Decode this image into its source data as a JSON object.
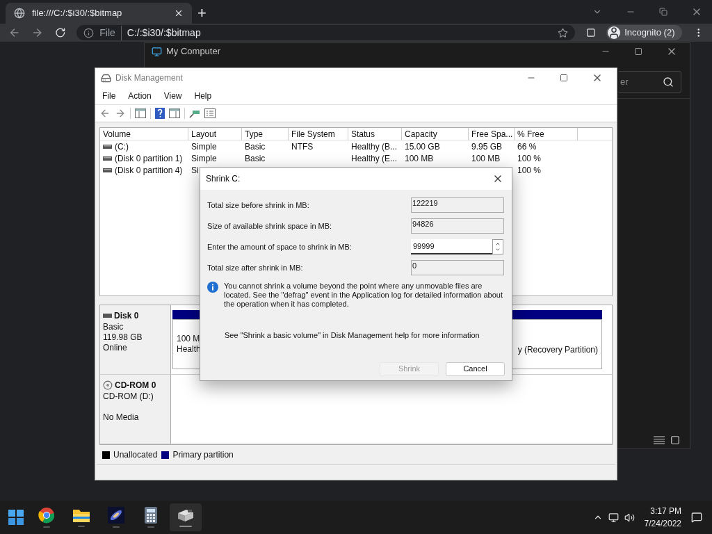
{
  "browser": {
    "tab_title": "file:///C:/:$i30/:$bitmap",
    "new_tab": "+",
    "address_scheme": "File",
    "address": "C:/:$i30/:$bitmap",
    "profile": "Incognito (2)"
  },
  "my_computer": {
    "title": "My Computer",
    "search": {
      "placeholder": "er"
    }
  },
  "disk_management": {
    "title": "Disk Management",
    "menu": [
      "File",
      "Action",
      "View",
      "Help"
    ],
    "table": {
      "columns": [
        "Volume",
        "Layout",
        "Type",
        "File System",
        "Status",
        "Capacity",
        "Free Spa...",
        "% Free"
      ],
      "rows": [
        {
          "cells": [
            " (C:)",
            "Simple",
            "Basic",
            "NTFS",
            "Healthy (B...",
            "15.00 GB",
            "9.95 GB",
            "66 %"
          ]
        },
        {
          "cells": [
            "(Disk 0 partition 1)",
            "Simple",
            "Basic",
            null,
            "Healthy (E...",
            "100 MB",
            "100 MB",
            "100 %"
          ]
        },
        {
          "cells": [
            "(Disk 0 partition 4)",
            "Si",
            null,
            null,
            null,
            null,
            null,
            "100 %"
          ]
        }
      ]
    },
    "disks": [
      {
        "kind": "disk",
        "name": "Disk 0",
        "lines": [
          "Basic",
          "119.98 GB",
          "Online"
        ],
        "partition_left": [
          "100 M",
          "Health"
        ],
        "partition_right": "y (Recovery Partition)"
      },
      {
        "kind": "cdrom",
        "name": "CD-ROM 0",
        "lines": [
          "CD-ROM (D:)",
          "No Media"
        ]
      }
    ],
    "legend": [
      {
        "label": "Unallocated",
        "color": "#000000"
      },
      {
        "label": "Primary partition",
        "color": "#000080"
      }
    ]
  },
  "dialog": {
    "title": "Shrink C:",
    "fields": [
      {
        "label": "Total size before shrink in MB:",
        "value": "122219",
        "kind": "readonly"
      },
      {
        "label": "Size of available shrink space in MB:",
        "value": "94826",
        "kind": "readonly"
      },
      {
        "label": "Enter the amount of space to shrink in MB:",
        "value": "99999",
        "kind": "spin"
      },
      {
        "label": "Total size after shrink in MB:",
        "value": "0",
        "kind": "readonly"
      }
    ],
    "info": "You cannot shrink a volume beyond the point where any unmovable files are located. See the \"defrag\" event in the Application log for detailed information about the operation when it has completed.",
    "help": "See \"Shrink a basic volume\" in Disk Management help for more information",
    "buttons": [
      {
        "label": "Shrink",
        "disabled": true
      },
      {
        "label": "Cancel",
        "disabled": false
      }
    ]
  },
  "taskbar": {
    "apps": [
      {
        "kind": "chrome",
        "selected": false
      },
      {
        "kind": "explorer",
        "selected": false
      },
      {
        "kind": "galaxy",
        "selected": false
      },
      {
        "kind": "calculator",
        "selected": false
      },
      {
        "kind": "diskmgmt",
        "selected": true
      }
    ],
    "time": "3:17 PM",
    "date": "7/24/2022"
  }
}
